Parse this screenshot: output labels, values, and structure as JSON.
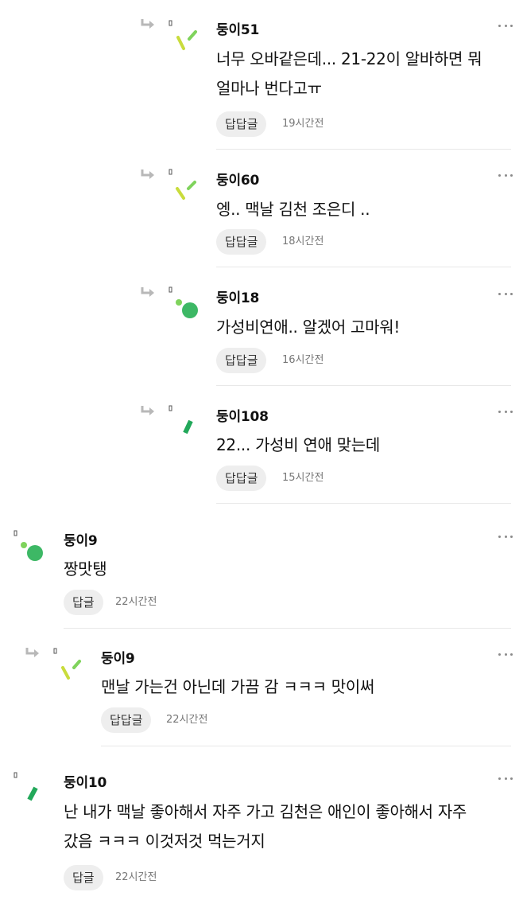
{
  "colors": {
    "lime": "#c9dc3c",
    "green_light": "#7fd35c",
    "green": "#3db865",
    "green_dark": "#22a85a"
  },
  "comments": [
    {
      "name": "둥이51",
      "text": "너무 오바같은데... 21-22이 알바하면 뭐\n얼마나 번다고ㅠ",
      "reply_label": "답답글",
      "time": "19시간전",
      "avatar_icon": "lime-sticks-icon"
    },
    {
      "name": "둥이60",
      "text": "엥.. 맥날 김천 조은디 ..",
      "reply_label": "답답글",
      "time": "18시간전",
      "avatar_icon": "lime-sticks-icon"
    },
    {
      "name": "둥이18",
      "text": "가성비연애.. 알겠어 고마워!",
      "reply_label": "답답글",
      "time": "16시간전",
      "avatar_icon": "green-dots-icon"
    },
    {
      "name": "둥이108",
      "text": "22... 가성비 연애 맞는데",
      "reply_label": "답답글",
      "time": "15시간전",
      "avatar_icon": "green-stick-icon"
    },
    {
      "name": "둥이9",
      "text": "짱맛탱",
      "reply_label": "답글",
      "time": "22시간전",
      "avatar_icon": "green-dots-icon"
    },
    {
      "name": "둥이9",
      "text": "맨날 가는건 아닌데 가끔 감 ㅋㅋㅋ 맛이써",
      "reply_label": "답답글",
      "time": "22시간전",
      "avatar_icon": "lime-sticks-icon"
    },
    {
      "name": "둥이10",
      "text": "난 내가 맥날 좋아해서 자주 가고 김천은 애인이 좋아해서 자주\n갔음 ㅋㅋㅋ 이것저것 먹는거지",
      "reply_label": "답글",
      "time": "22시간전",
      "avatar_icon": "green-stick-icon"
    }
  ]
}
